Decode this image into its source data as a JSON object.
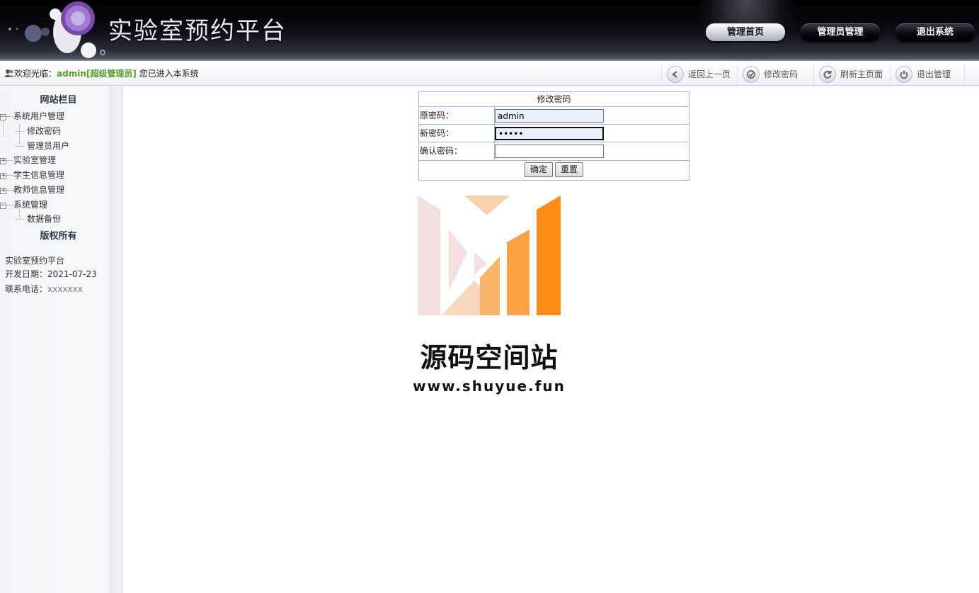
{
  "header": {
    "app_title": "实验室预约平台",
    "nav": [
      {
        "label": "管理首页",
        "active": true
      },
      {
        "label": "管理员管理",
        "active": false
      },
      {
        "label": "退出系统",
        "active": false
      }
    ]
  },
  "toolbar": {
    "welcome_prefix": "欢迎光临：",
    "user_name": "admin[超级管理员]",
    "welcome_suffix": " 您已进入本系统",
    "actions": [
      {
        "label": "返回上一页",
        "icon": "back-arrow-icon"
      },
      {
        "label": "修改密码",
        "icon": "check-key-icon"
      },
      {
        "label": "刷新主页面",
        "icon": "refresh-icon"
      },
      {
        "label": "退出管理",
        "icon": "power-icon"
      }
    ]
  },
  "sidebar": {
    "heading": "网站栏目",
    "tree": [
      {
        "label": "系统用户管理",
        "expanded": true,
        "children": [
          "修改密码",
          "管理员用户"
        ]
      },
      {
        "label": "实验室管理",
        "expanded": false
      },
      {
        "label": "学生信息管理",
        "expanded": false
      },
      {
        "label": "教师信息管理",
        "expanded": false
      },
      {
        "label": "系统管理",
        "expanded": true,
        "children": [
          "数据备份"
        ]
      }
    ],
    "copyright_heading": "版权所有",
    "info": {
      "name": "实验室预约平台",
      "date_label": "开发日期：",
      "date_value": "2021-07-23",
      "phone_label": "联系电话：",
      "phone_value": "xxxxxxx"
    }
  },
  "form": {
    "title": "修改密码",
    "fields": [
      {
        "label": "原密码：",
        "value": "admin"
      },
      {
        "label": "新密码：",
        "value": "•••••"
      },
      {
        "label": "确认密码：",
        "value": ""
      }
    ],
    "submit_label": "确定",
    "reset_label": "重置"
  },
  "watermark": {
    "brand": "源码空间站",
    "url": "www.shuyue.fun",
    "colors": [
      "#f4dfdf",
      "#f9cda6",
      "#fbb36a",
      "#fb8c16"
    ]
  }
}
